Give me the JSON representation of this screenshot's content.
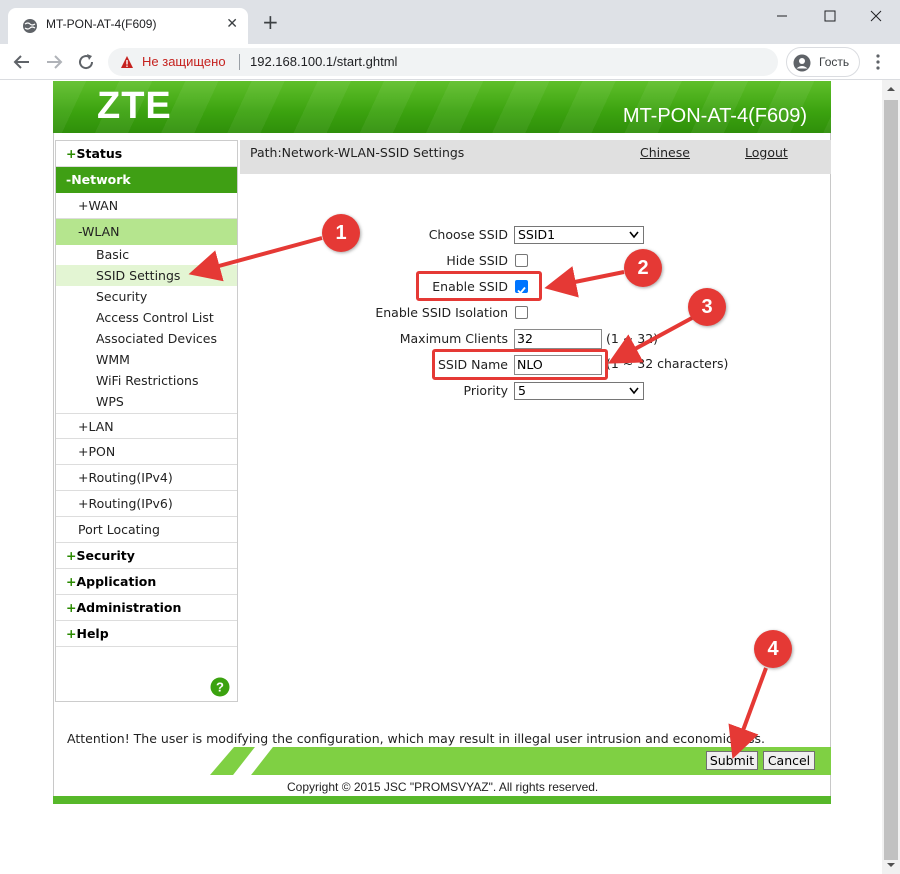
{
  "browser": {
    "tab_title": "MT-PON-AT-4(F609)",
    "tab_close": "✕",
    "new_tab": "+",
    "security_warning": "Не защищено",
    "url": "192.168.100.1/start.ghtml",
    "profile_label": "Гость",
    "icons": [
      "globe-icon",
      "back-arrow-icon",
      "forward-arrow-icon",
      "reload-icon",
      "warning-triangle-icon",
      "profile-icon",
      "kebab-menu-icon",
      "minimize-icon",
      "maximize-icon",
      "close-icon"
    ]
  },
  "header": {
    "logo": "ZTE",
    "model": "MT-PON-AT-4(F609)"
  },
  "sidebar": {
    "status": "Status",
    "network": "Network",
    "wan": "WAN",
    "wlan": "WLAN",
    "wlan_items": [
      "Basic",
      "SSID Settings",
      "Security",
      "Access Control List",
      "Associated Devices",
      "WMM",
      "WiFi Restrictions",
      "WPS"
    ],
    "lan": "LAN",
    "pon": "PON",
    "routing_v4": "Routing(IPv4)",
    "routing_v6": "Routing(IPv6)",
    "port_locating": "Port Locating",
    "security": "Security",
    "application": "Application",
    "administration": "Administration",
    "help": "Help",
    "plus": "+",
    "minus": "-",
    "help_icon": "?"
  },
  "path": {
    "text": "Path:Network-WLAN-SSID Settings",
    "chinese": "Chinese",
    "logout": "Logout"
  },
  "form": {
    "choose_ssid_label": "Choose SSID",
    "choose_ssid_value": "SSID1",
    "hide_ssid_label": "Hide SSID",
    "hide_ssid_checked": false,
    "enable_ssid_label": "Enable SSID",
    "enable_ssid_checked": true,
    "isolation_label": "Enable SSID Isolation",
    "isolation_checked": false,
    "max_clients_label": "Maximum Clients",
    "max_clients_value": "32",
    "max_clients_hint": "(1 ~ 32)",
    "ssid_name_label": "SSID Name",
    "ssid_name_value": "NLO",
    "ssid_name_hint": "(1 ~ 32 characters)",
    "priority_label": "Priority",
    "priority_value": "5"
  },
  "footer": {
    "attention": "Attention! The user is modifying the configuration, which may result in illegal user intrusion and economic loss.",
    "submit": "Submit",
    "cancel": "Cancel",
    "copyright": "Copyright © 2015 JSC \"PROMSVYAZ\". All rights reserved."
  },
  "annotations": {
    "badges": [
      "1",
      "2",
      "3",
      "4"
    ],
    "accent_color": "#e53935"
  }
}
